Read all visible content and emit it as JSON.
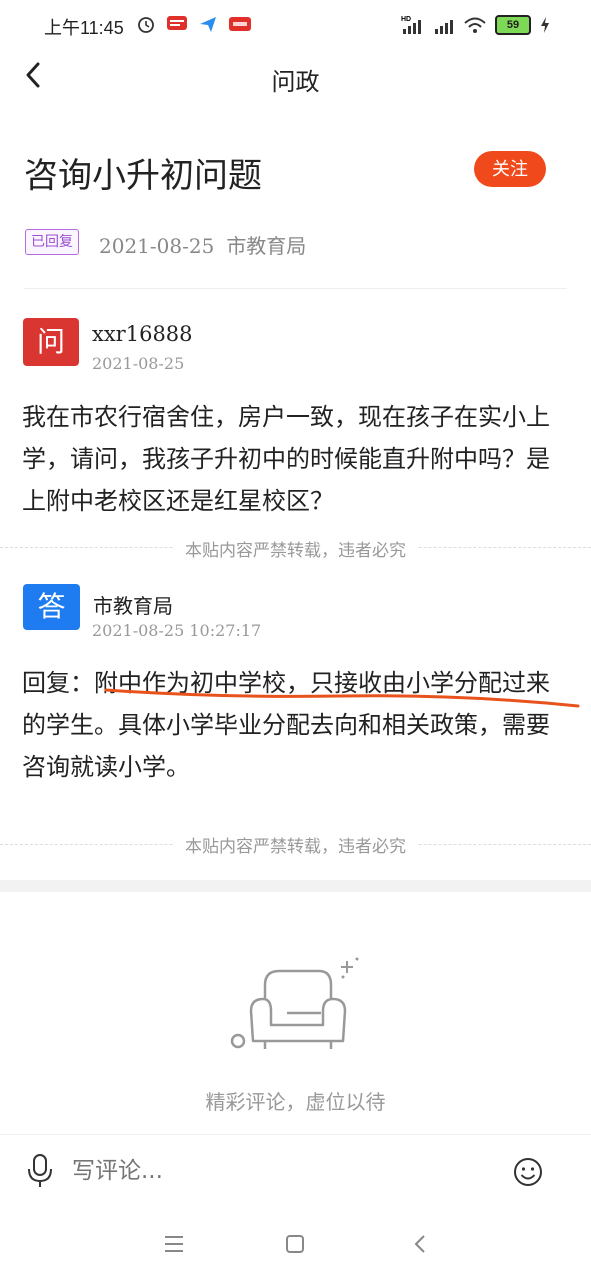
{
  "status_bar": {
    "time": "上午11:45",
    "battery": "59",
    "signal_label": "HD"
  },
  "header": {
    "title": "问政"
  },
  "post": {
    "title": "咨询小升初问题",
    "follow_label": "关注",
    "status_badge": "已回复",
    "date": "2021-08-25",
    "department": "市教育局"
  },
  "question": {
    "avatar_char": "问",
    "author": "xxr16888",
    "date": "2021-08-25",
    "text": "我在市农行宿舍住，房户一致，现在孩子在实小上学，请问，我孩子升初中的时候能直升附中吗？是上附中老校区还是红星校区？"
  },
  "notice_text": "本贴内容严禁转载，违者必究",
  "answer": {
    "avatar_char": "答",
    "author": "市教育局",
    "datetime": "2021-08-25 10:27:17",
    "text": "回复：附中作为初中学校，只接收由小学分配过来的学生。具体小学毕业分配去向和相关政策，需要咨询就读小学。"
  },
  "comments": {
    "empty_text": "精彩评论，虚位以待",
    "input_placeholder": "写评论..."
  },
  "colors": {
    "accent": "#f04a1c",
    "question_avatar": "#d93632",
    "answer_avatar": "#1e7cf0",
    "badge": "#9b4fd0",
    "annotation": "#e8531d"
  },
  "icons": [
    "back-icon",
    "microphone-icon",
    "emoji-icon",
    "menu-icon",
    "home-icon",
    "nav-back-icon",
    "sofa-icon"
  ]
}
